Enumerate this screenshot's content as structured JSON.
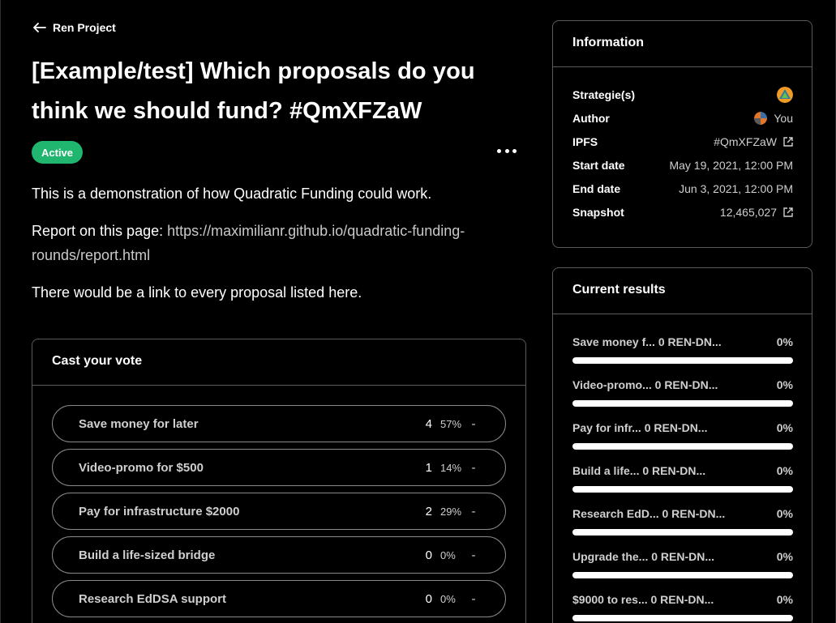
{
  "header": {
    "back_label": "Ren Project"
  },
  "proposal": {
    "title": "[Example/test] Which proposals do you think we should fund? #QmXFZaW",
    "state": "Active",
    "body": {
      "p1": "This is a demonstration of how Quadratic Funding could work.",
      "p2_prefix": "Report on this page: ",
      "p2_link": "https://maximilianr.github.io/quadratic-funding-rounds/report.html",
      "p3": "There would be a link to every proposal listed here."
    }
  },
  "vote": {
    "title": "Cast your vote",
    "choices": [
      {
        "label": "Save money for later",
        "count": "4",
        "pct": "57%",
        "minus": "-"
      },
      {
        "label": "Video-promo for $500",
        "count": "1",
        "pct": "14%",
        "minus": "-"
      },
      {
        "label": "Pay for infrastructure $2000",
        "count": "2",
        "pct": "29%",
        "minus": "-"
      },
      {
        "label": "Build a life-sized bridge",
        "count": "0",
        "pct": "0%",
        "minus": "-"
      },
      {
        "label": "Research EdDSA support",
        "count": "0",
        "pct": "0%",
        "minus": "-"
      }
    ]
  },
  "information": {
    "title": "Information",
    "rows": {
      "strategies": {
        "key": "Strategie(s)"
      },
      "author": {
        "key": "Author",
        "value": "You"
      },
      "ipfs": {
        "key": "IPFS",
        "value": "#QmXFZaW"
      },
      "start": {
        "key": "Start date",
        "value": "May 19, 2021, 12:00 PM"
      },
      "end": {
        "key": "End date",
        "value": "Jun 3, 2021, 12:00 PM"
      },
      "snapshot": {
        "key": "Snapshot",
        "value": "12,465,027"
      }
    }
  },
  "results": {
    "title": "Current results",
    "items": [
      {
        "label": "Save money f... 0 REN-DN...",
        "pct": "0%",
        "fraction": 0
      },
      {
        "label": "Video-promo... 0 REN-DN...",
        "pct": "0%",
        "fraction": 0
      },
      {
        "label": "Pay for infr... 0 REN-DN...",
        "pct": "0%",
        "fraction": 0
      },
      {
        "label": "Build a life... 0 REN-DN...",
        "pct": "0%",
        "fraction": 0
      },
      {
        "label": "Research EdD... 0 REN-DN...",
        "pct": "0%",
        "fraction": 0
      },
      {
        "label": "Upgrade the... 0 REN-DN...",
        "pct": "0%",
        "fraction": 0
      },
      {
        "label": "$9000 to res... 0 REN-DN...",
        "pct": "0%",
        "fraction": 0
      }
    ]
  },
  "colors": {
    "accent": "#21b66f",
    "background": "#000000",
    "border": "#5a5a5a"
  },
  "icons": {
    "back": "arrow-left-icon",
    "menu": "more-dots-icon",
    "external": "external-link-icon"
  }
}
